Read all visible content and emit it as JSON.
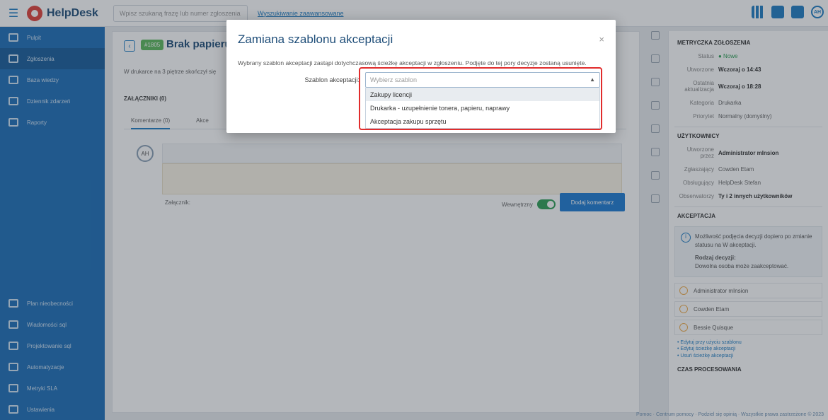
{
  "topbar": {
    "app_name": "HelpDesk",
    "search_placeholder": "Wpisz szukaną frazę lub numer zgłoszenia",
    "advanced_link": "Wyszukiwanie zaawansowane"
  },
  "sidebar": {
    "items": [
      {
        "label": "Pulpit"
      },
      {
        "label": "Zgłoszenia"
      },
      {
        "label": "Baza wiedzy"
      },
      {
        "label": "Dziennik zdarzeń"
      },
      {
        "label": "Raporty"
      }
    ],
    "bottom_items": [
      {
        "label": "Plan nieobecności"
      },
      {
        "label": "Wiadomości sql"
      },
      {
        "label": "Projektowanie sql"
      },
      {
        "label": "Automatyzacje"
      },
      {
        "label": "Metryki SLA"
      },
      {
        "label": "Ustawienia"
      }
    ]
  },
  "ticket": {
    "id": "#1805",
    "title": "Brak papieru",
    "description": "W drukarce na 3 piętrze skończył się",
    "attachments_heading": "ZAŁĄCZNIKI (0)",
    "tab_comments": "Komentarze (0)",
    "tab_accept": "Akce",
    "avatar_initials": "AH",
    "attach_label": "Załącznik:",
    "internal_label": "Wewnętrzny",
    "add_comment_button": "Dodaj komentarz"
  },
  "right_panel": {
    "metrics_heading": "METRYCZKA ZGŁOSZENIA",
    "metrics": [
      {
        "key": "Status",
        "value": "● Nowe"
      },
      {
        "key": "Utworzone",
        "value": "Wczoraj o 14:43"
      },
      {
        "key": "Ostatnia aktualizacja",
        "value": "Wczoraj o 18:28"
      },
      {
        "key": "Kategoria",
        "value": "Drukarka"
      },
      {
        "key": "Priorytet",
        "value": "Normalny (domyślny)"
      }
    ],
    "users_heading": "UŻYTKOWNICY",
    "users": [
      {
        "key": "Utworzone przez",
        "value": "Administrator mInsion"
      },
      {
        "key": "Zgłaszający",
        "value": "Cowden Etam"
      },
      {
        "key": "Obsługujący",
        "value": "HelpDesk Stefan"
      },
      {
        "key": "Obserwatorzy",
        "value": "Ty i 2 innych użytkowników"
      }
    ],
    "accept_heading": "AKCEPTACJA",
    "accept_info": "Możliwość podjęcia decyzji dopiero po zmianie statusu na W akceptacji.",
    "decision_type": "Rodzaj decyzji:",
    "decision_desc": "Dowolna osoba może zaakceptować.",
    "approvers": [
      "Administrator mInsion",
      "Cowden Etam",
      "Bessie Quisque"
    ],
    "links": [
      "• Edytuj przy użyciu szablonu",
      "• Edytuj ścieżkę akceptacji",
      "• Usuń ścieżkę akceptacji"
    ],
    "process_heading": "CZAS PROCESOWANIA"
  },
  "footer": {
    "text": "Pomoc · Centrum pomocy · Podziel się opinią · Wszystkie prawa zastrzeżone © 2023"
  },
  "modal": {
    "title": "Zamiana szablonu akceptacji",
    "close_icon_glyph": "×",
    "info": "Wybrany szablon akceptacji zastąpi dotychczasową ścieżkę akceptacji w zgłoszeniu. Podjęte do tej pory decyzje zostaną usunięte.",
    "field_label": "Szablon akceptacji:",
    "select_placeholder": "Wybierz szablon",
    "options": [
      "Zakupy licencji",
      "Drukarka - uzupełnienie tonera, papieru, naprawy",
      "Akceptacja zakupu sprzętu"
    ]
  },
  "colors": {
    "brand": "#1f4e79",
    "sidebar": "#1e6fb8",
    "highlight": "#e12c2c",
    "accent": "#1e7bd3",
    "success": "#2e9e56"
  }
}
